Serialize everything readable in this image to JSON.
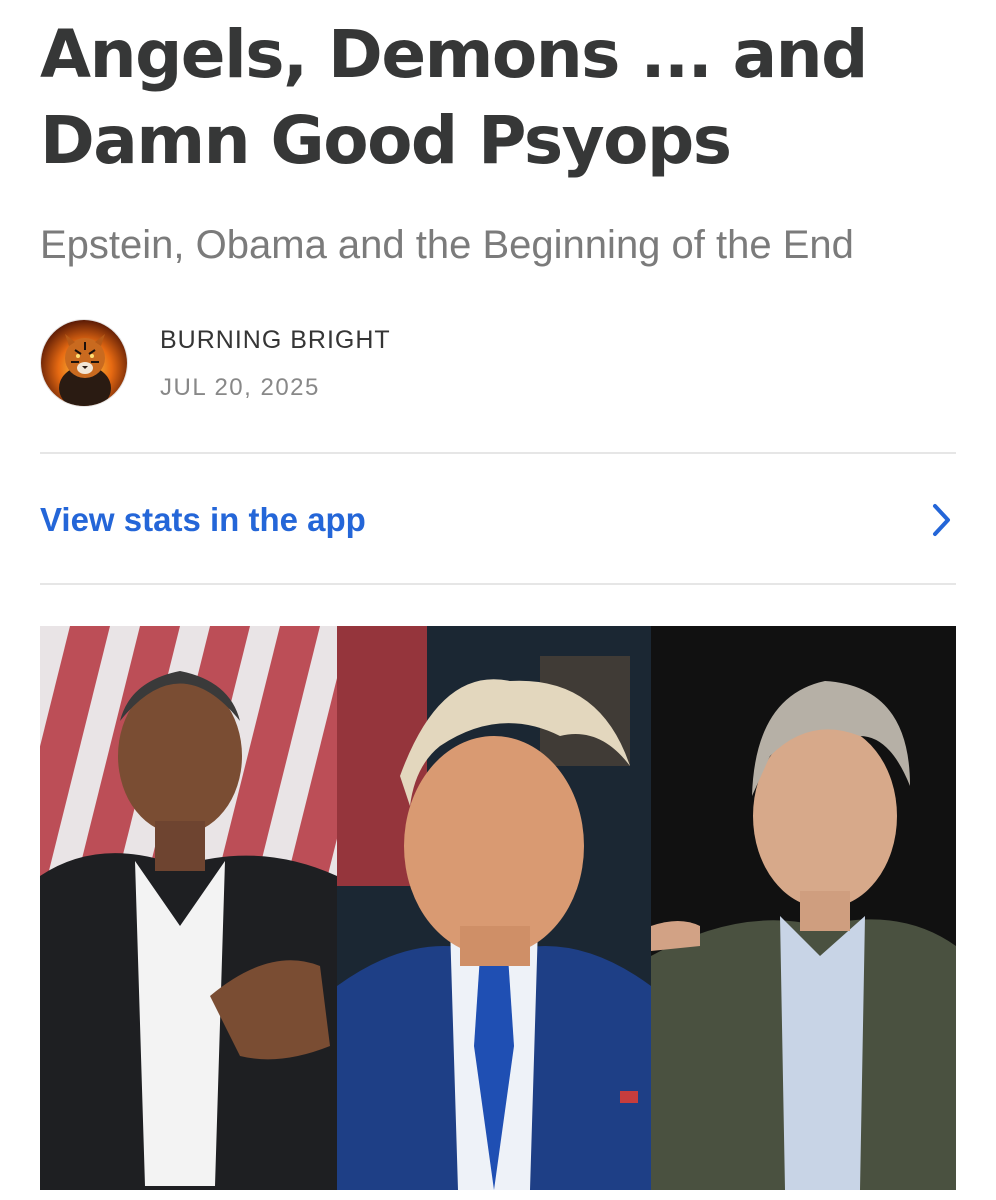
{
  "post": {
    "title": "Angels, Demons ... and Damn Good Psyops",
    "subtitle": "Epstein, Obama and the Beginning of the End",
    "author": "BURNING BRIGHT",
    "date": "JUL 20, 2025"
  },
  "stats": {
    "link_label": "View stats in the app",
    "icon": "chevron-right-icon"
  },
  "avatar": {
    "icon": "tiger-avatar"
  },
  "hero": {
    "icon": "three-portrait-photo-collage"
  },
  "colors": {
    "link": "#2466d8",
    "title": "#363737",
    "subtitle": "#7b7b7b",
    "divider": "#e6e6e6"
  }
}
